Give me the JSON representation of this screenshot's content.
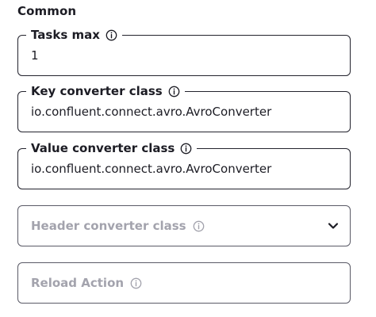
{
  "section": {
    "title": "Common"
  },
  "fields": {
    "tasks_max": {
      "label": "Tasks max",
      "value": "1"
    },
    "key_converter_class": {
      "label": "Key converter class",
      "value": "io.confluent.connect.avro.AvroConverter"
    },
    "value_converter_class": {
      "label": "Value converter class",
      "value": "io.confluent.connect.avro.AvroConverter"
    },
    "header_converter_class": {
      "placeholder": "Header converter class",
      "value": ""
    },
    "reload_action": {
      "placeholder": "Reload Action",
      "value": ""
    }
  },
  "icons": {
    "info": "info-circle-icon",
    "dropdown": "chevron-down-icon"
  },
  "colors": {
    "text": "#1c1c24",
    "border": "#23232d",
    "placeholder": "#a3a3ad"
  }
}
